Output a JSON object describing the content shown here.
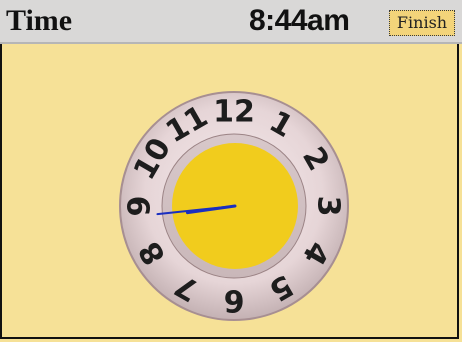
{
  "header": {
    "title": "Time",
    "time": "8:44am",
    "finish_label": "Finish"
  },
  "clock": {
    "numerals": [
      "12",
      "1",
      "2",
      "3",
      "4",
      "5",
      "6",
      "7",
      "8",
      "9",
      "10",
      "11"
    ],
    "hour": 8,
    "minute": 44
  },
  "colors": {
    "background": "#f6e197",
    "titlebar": "#d9d8d7",
    "dial_face": "#f1cc1d",
    "dial_ring": "#e6d5d7",
    "hands": "#1a2fc0",
    "finish_button": "#f3d47a"
  }
}
